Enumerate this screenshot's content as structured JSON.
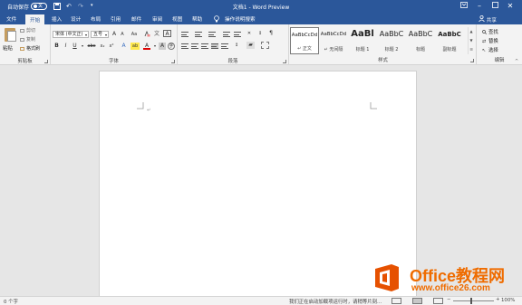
{
  "titlebar": {
    "autosave_label": "自动保存",
    "autosave_state": "关",
    "title": "文档1 - Word Preview"
  },
  "tabs": [
    {
      "label": "文件"
    },
    {
      "label": "开始"
    },
    {
      "label": "插入"
    },
    {
      "label": "设计"
    },
    {
      "label": "布局"
    },
    {
      "label": "引用"
    },
    {
      "label": "邮件"
    },
    {
      "label": "审阅"
    },
    {
      "label": "视图"
    },
    {
      "label": "帮助"
    }
  ],
  "tell_me": "操作说明搜索",
  "share_label": "共享",
  "clipboard": {
    "paste": "粘贴",
    "cut": "剪切",
    "copy": "复制",
    "format_painter": "格式刷",
    "group_label": "剪贴板"
  },
  "font": {
    "font_name": "宋体 (中文正)",
    "font_size": "五号",
    "grow": "A",
    "shrink": "A",
    "case": "Aa",
    "bold": "B",
    "italic": "I",
    "underline": "U",
    "strike": "abc",
    "subscript": "x₂",
    "superscript": "x²",
    "highlight": "ab",
    "font_color": "A",
    "group_label": "字体"
  },
  "paragraph": {
    "group_label": "段落"
  },
  "styles": {
    "items": [
      {
        "preview": "AaBbCcDd",
        "name": "↵ 正文"
      },
      {
        "preview": "AaBbCcDd",
        "name": "↵ 无间隔"
      },
      {
        "preview": "AaBl",
        "name": "标题 1"
      },
      {
        "preview": "AaBbC",
        "name": "标题 2"
      },
      {
        "preview": "AaBbC",
        "name": "标题"
      },
      {
        "preview": "AaBbC",
        "name": "副标题"
      }
    ],
    "group_label": "样式"
  },
  "editing": {
    "find": "查找",
    "replace": "替换",
    "select": "选择",
    "group_label": "编辑"
  },
  "document": {
    "paragraph_mark": "↵"
  },
  "statusbar": {
    "word_count": "0 个字",
    "addin_status": "我们正在启动加载项运行时，请稍等片刻...",
    "zoom": "100%"
  },
  "watermark": {
    "title": "Office教程网",
    "url": "www.office26.com"
  },
  "colors": {
    "brand": "#2b579a",
    "watermark": "#ef6c00"
  }
}
